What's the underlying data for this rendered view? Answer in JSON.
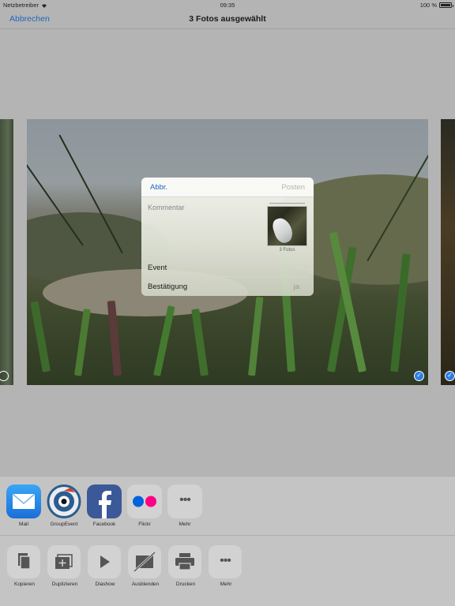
{
  "status_bar": {
    "carrier": "Netzbetreiber",
    "time": "09:35",
    "battery": "100 %",
    "battery_level": 1.0
  },
  "nav": {
    "cancel": "Abbrechen",
    "title": "3 Fotos ausgewählt"
  },
  "compose": {
    "cancel": "Abbr.",
    "post": "Posten",
    "comment_placeholder": "Kommentar",
    "thumb_caption": "3 Fotos",
    "rows": [
      {
        "label": "Event",
        "value": ""
      },
      {
        "label": "Bestätigung",
        "value": "ja"
      }
    ]
  },
  "share_apps": [
    {
      "label": "Mail",
      "icon": "mail-icon"
    },
    {
      "label": "GroupEvent",
      "icon": "groupevent-icon"
    },
    {
      "label": "Facebook",
      "icon": "facebook-icon"
    },
    {
      "label": "Flickr",
      "icon": "flickr-icon"
    },
    {
      "label": "Mehr",
      "icon": "more-icon"
    }
  ],
  "share_actions": [
    {
      "label": "Kopieren",
      "icon": "copy-icon"
    },
    {
      "label": "Duplizieren",
      "icon": "duplicate-icon"
    },
    {
      "label": "Diashow",
      "icon": "play-icon"
    },
    {
      "label": "Ausblenden",
      "icon": "hide-icon"
    },
    {
      "label": "Drucken",
      "icon": "print-icon"
    },
    {
      "label": "Mehr",
      "icon": "more-icon"
    }
  ],
  "colors": {
    "accent": "#2069b8",
    "checkmark": "#2f7de0",
    "flickr_blue": "#0063dc",
    "flickr_pink": "#ff0084",
    "facebook": "#3b5998"
  }
}
